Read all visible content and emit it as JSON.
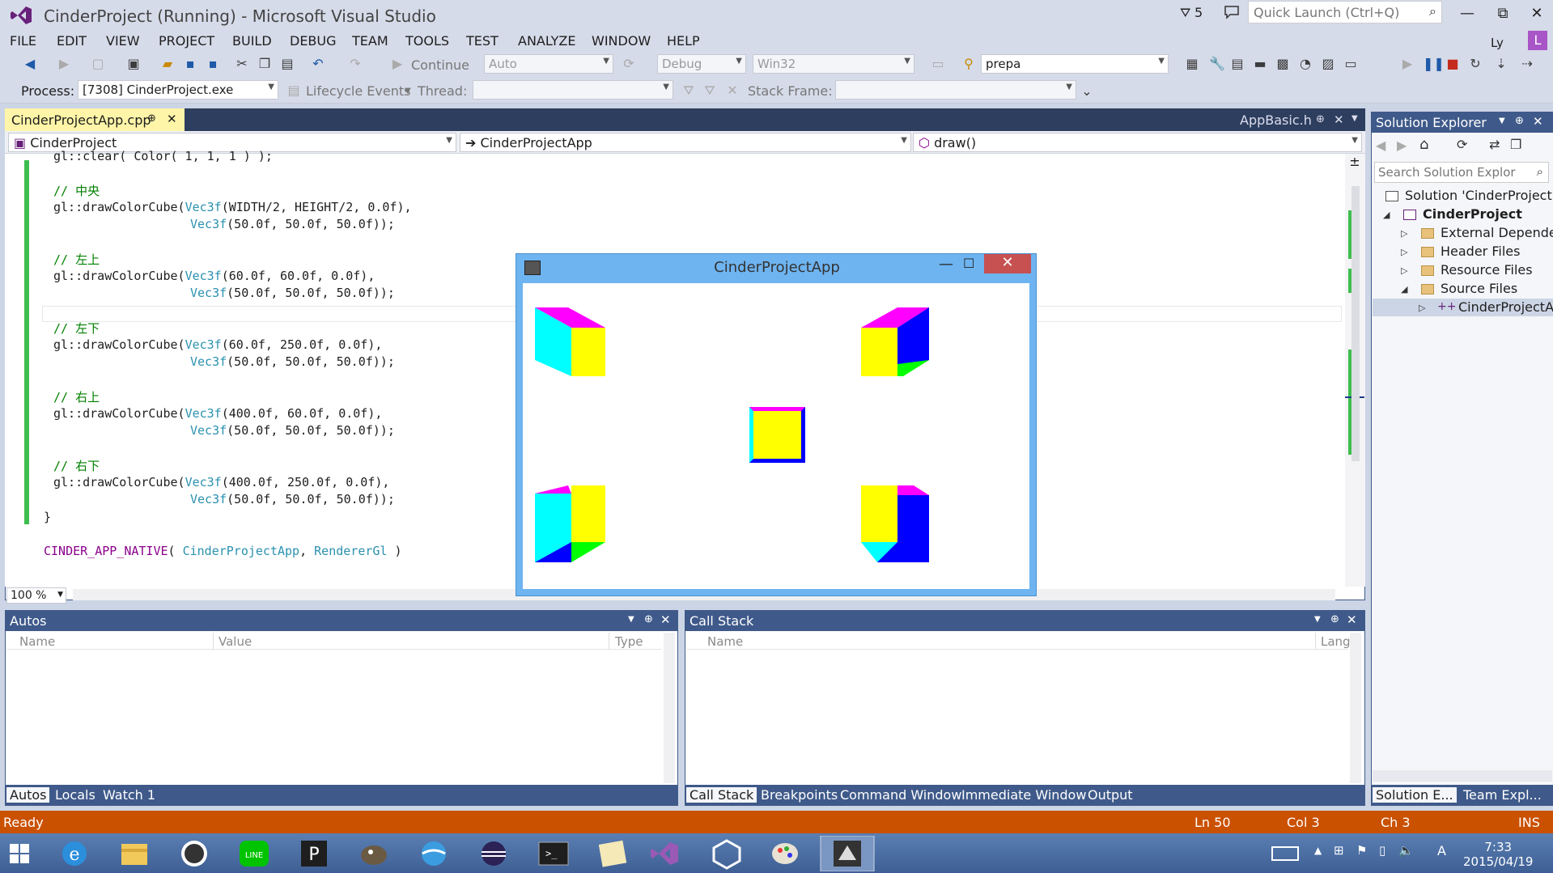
{
  "window": {
    "title": "CinderProject (Running) - Microsoft Visual Studio",
    "notifications": "5",
    "quick_launch_placeholder": "Quick Launch (Ctrl+Q)",
    "user": "Ly",
    "avatar_letter": "L"
  },
  "menu": [
    "FILE",
    "EDIT",
    "VIEW",
    "PROJECT",
    "BUILD",
    "DEBUG",
    "TEAM",
    "TOOLS",
    "TEST",
    "ANALYZE",
    "WINDOW",
    "HELP"
  ],
  "toolbar": {
    "continue_label": "Continue",
    "auto_combo": "Auto",
    "config_combo": "Debug",
    "platform_combo": "Win32",
    "find_combo": "prepa"
  },
  "debug_bar": {
    "process_label": "Process:",
    "process_value": "[7308] CinderProject.exe",
    "lifecycle_label": "Lifecycle Events",
    "thread_label": "Thread:",
    "stack_frame_label": "Stack Frame:"
  },
  "editor": {
    "active_tab": "CinderProjectApp.cpp",
    "other_tab": "AppBasic.h",
    "nav_project": "CinderProject",
    "nav_class": "CinderProjectApp",
    "nav_member": "draw()",
    "zoom": "100 %",
    "lines": [
      {
        "kind": "plain",
        "text": "gl::clear( Color( 1, 1, 1 ) );"
      },
      {
        "kind": "cmt",
        "text": "// 中央"
      },
      {
        "kind": "code",
        "pre": "gl::drawColorCube(",
        "type": "Vec3f",
        "post": "(WIDTH/2, HEIGHT/2, 0.0f),"
      },
      {
        "kind": "cont",
        "type": "Vec3f",
        "post": "(50.0f, 50.0f, 50.0f));"
      },
      {
        "kind": "cmt",
        "text": "// 左上"
      },
      {
        "kind": "code",
        "pre": "gl::drawColorCube(",
        "type": "Vec3f",
        "post": "(60.0f, 60.0f, 0.0f),"
      },
      {
        "kind": "cont",
        "type": "Vec3f",
        "post": "(50.0f, 50.0f, 50.0f));"
      },
      {
        "kind": "cmt",
        "text": "// 左下"
      },
      {
        "kind": "code",
        "pre": "gl::drawColorCube(",
        "type": "Vec3f",
        "post": "(60.0f, 250.0f, 0.0f),"
      },
      {
        "kind": "cont",
        "type": "Vec3f",
        "post": "(50.0f, 50.0f, 50.0f));"
      },
      {
        "kind": "cmt",
        "text": "// 右上"
      },
      {
        "kind": "code",
        "pre": "gl::drawColorCube(",
        "type": "Vec3f",
        "post": "(400.0f, 60.0f, 0.0f),"
      },
      {
        "kind": "cont",
        "type": "Vec3f",
        "post": "(50.0f, 50.0f, 50.0f));"
      },
      {
        "kind": "cmt",
        "text": "// 右下"
      },
      {
        "kind": "code",
        "pre": "gl::drawColorCube(",
        "type": "Vec3f",
        "post": "(400.0f, 250.0f, 0.0f),"
      },
      {
        "kind": "cont",
        "type": "Vec3f",
        "post": "(50.0f, 50.0f, 50.0f));"
      },
      {
        "kind": "plain",
        "text": "}"
      }
    ],
    "macro_line": {
      "macro": "CINDER_APP_NATIVE",
      "open": "( ",
      "arg1": "CinderProjectApp",
      "sep": ", ",
      "arg2": "RendererGl",
      "close": " )"
    }
  },
  "app_window": {
    "title": "CinderProjectApp",
    "close_glyph": "✕"
  },
  "solution_explorer": {
    "title": "Solution Explorer",
    "search_placeholder": "Search Solution Explor",
    "items": [
      {
        "label": "Solution 'CinderProject'"
      },
      {
        "label": "CinderProject"
      },
      {
        "label": "External Depende"
      },
      {
        "label": "Header Files"
      },
      {
        "label": "Resource Files"
      },
      {
        "label": "Source Files"
      },
      {
        "label": "CinderProjectA"
      }
    ],
    "tabs": [
      "Solution E...",
      "Team Expl..."
    ]
  },
  "autos_panel": {
    "title": "Autos",
    "columns": [
      "Name",
      "Value",
      "Type"
    ],
    "tabs": [
      "Autos",
      "Locals",
      "Watch 1"
    ]
  },
  "callstack_panel": {
    "title": "Call Stack",
    "columns": [
      "Name",
      "Lang"
    ],
    "tabs": [
      "Call Stack",
      "Breakpoints",
      "Command Window",
      "Immediate Window",
      "Output"
    ]
  },
  "status": {
    "state": "Ready",
    "line": "Ln 50",
    "col": "Col 3",
    "ch": "Ch 3",
    "mode": "INS"
  },
  "clock": {
    "time": "7:33",
    "date": "2015/04/19"
  },
  "colors": {
    "status_bar": "#ca5100",
    "panel_header": "#3f5a8a",
    "active_tab": "#fff5a8",
    "cube_magenta": "#ff00ff",
    "cube_cyan": "#00ffff",
    "cube_yellow": "#ffff00",
    "cube_blue": "#0000ff",
    "cube_green": "#00ff00"
  }
}
